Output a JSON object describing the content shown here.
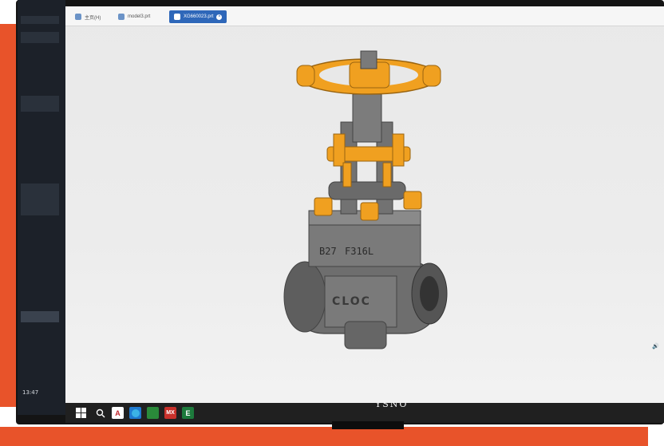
{
  "window": {
    "tabs": [
      {
        "label": "主页(H)",
        "active": false
      },
      {
        "label": "model3.prt",
        "active": false
      },
      {
        "label": "XG660023.prt",
        "active": true
      }
    ]
  },
  "model": {
    "casting_marks": [
      "B27",
      "F316L",
      "CLOC"
    ]
  },
  "taskbar": {
    "time": "13:47",
    "app_letters": [
      "A",
      "W",
      "MX",
      "E"
    ]
  },
  "monitor": {
    "brand": "YSNO"
  },
  "colors": {
    "accent": "#e8532a",
    "handwheel": "#f0a020",
    "valve_body": "#707070",
    "screen_bg": "#ececec",
    "tab_active": "#2e67b9"
  }
}
